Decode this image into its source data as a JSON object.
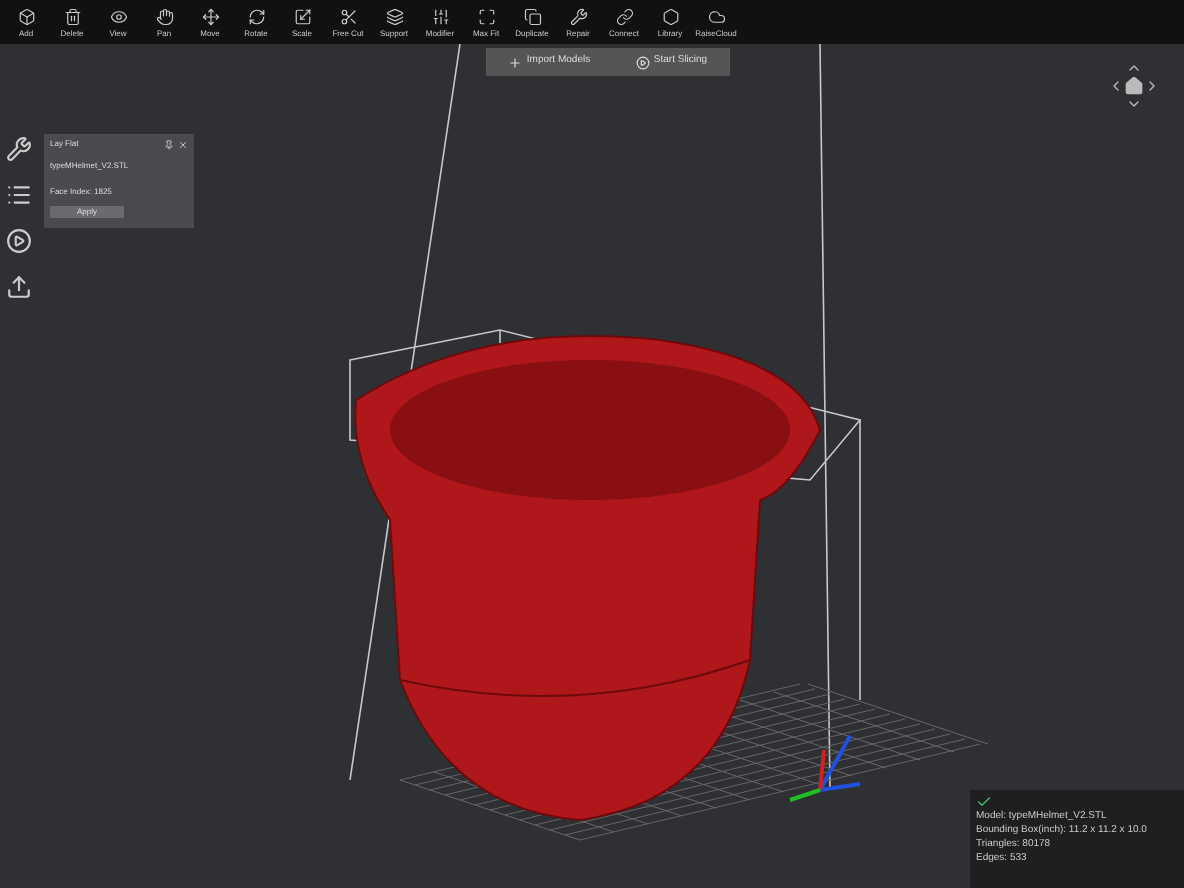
{
  "toolbar": [
    {
      "label": "Add"
    },
    {
      "label": "Delete"
    },
    {
      "label": "View"
    },
    {
      "label": "Pan"
    },
    {
      "label": "Move"
    },
    {
      "label": "Rotate"
    },
    {
      "label": "Scale"
    },
    {
      "label": "Free Cut"
    },
    {
      "label": "Support"
    },
    {
      "label": "Modifier"
    },
    {
      "label": "Max Fit"
    },
    {
      "label": "Duplicate"
    },
    {
      "label": "Repair"
    },
    {
      "label": "Connect"
    },
    {
      "label": "Library"
    },
    {
      "label": "RaiseCloud"
    }
  ],
  "actions": [
    "Import Models",
    "Start Slicing"
  ],
  "lay_flat": {
    "title": "Lay Flat",
    "model": "typeMHelmet_V2.STL",
    "face_index": "Face Index: 1825",
    "button": "Apply"
  },
  "model_info": [
    "Model: typeMHelmet_V2.STL",
    "Bounding Box(inch): 11.2 x 11.2 x 10.0",
    "Triangles: 80178",
    "Edges: 533"
  ]
}
